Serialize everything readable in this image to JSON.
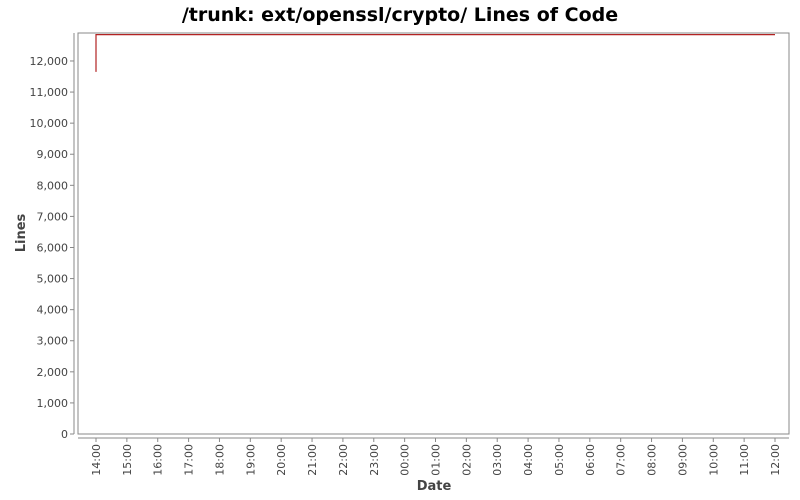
{
  "chart_data": {
    "type": "line",
    "title": "/trunk: ext/openssl/crypto/ Lines of Code",
    "xlabel": "Date",
    "ylabel": "Lines",
    "x_ticks": [
      "14:00",
      "15:00",
      "16:00",
      "17:00",
      "18:00",
      "19:00",
      "20:00",
      "21:00",
      "22:00",
      "23:00",
      "00:00",
      "01:00",
      "02:00",
      "03:00",
      "04:00",
      "05:00",
      "06:00",
      "07:00",
      "08:00",
      "09:00",
      "10:00",
      "11:00",
      "12:00"
    ],
    "y_ticks": [
      "0",
      "1,000",
      "2,000",
      "3,000",
      "4,000",
      "5,000",
      "6,000",
      "7,000",
      "8,000",
      "9,000",
      "10,000",
      "11,000",
      "12,000"
    ],
    "ylim": [
      0,
      12900
    ],
    "xlim": [
      "13:35",
      "12:30 (next day)"
    ],
    "grid": false,
    "series": [
      {
        "color": "#b22222",
        "x": [
          "14:00",
          "14:00",
          "12:00 (next day)"
        ],
        "y": [
          11650,
          12850,
          12850
        ]
      }
    ]
  }
}
